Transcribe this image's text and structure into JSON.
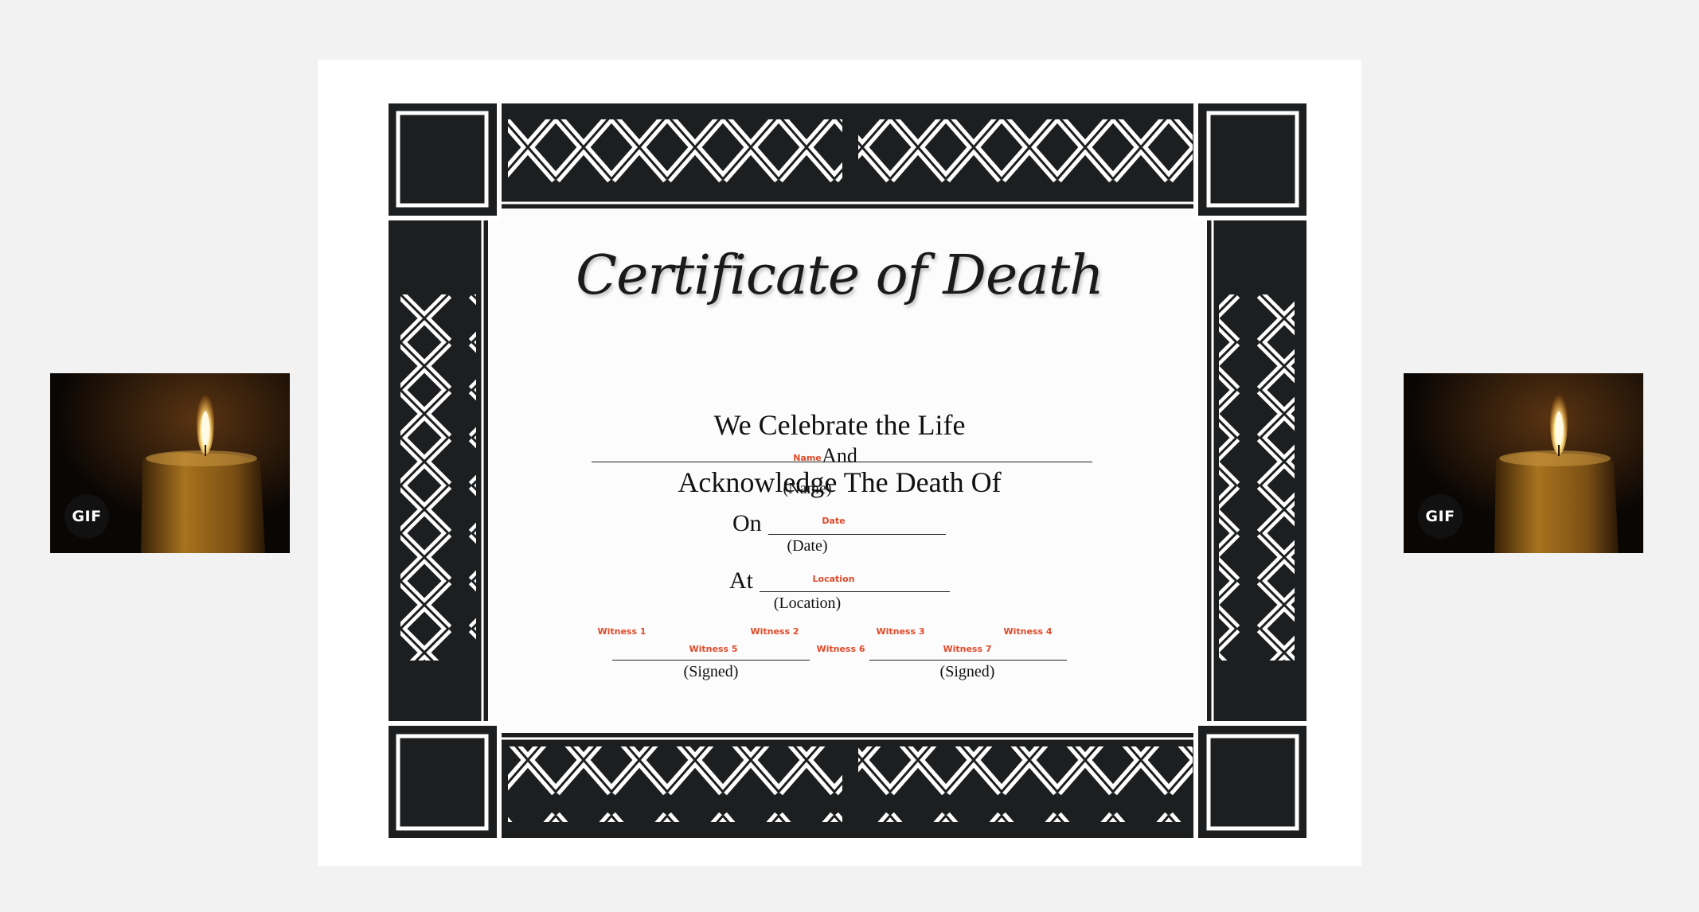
{
  "gifs": [
    {
      "badge": "GIF",
      "alt": "candle-icon"
    },
    {
      "badge": "GIF",
      "alt": "candle-icon"
    }
  ],
  "certificate": {
    "title": "Certificate of Death",
    "line1": "We Celebrate the Life",
    "line2": "And",
    "line3": "Acknowledge The Death Of",
    "name_field": "Name",
    "name_caption": "(Name)",
    "on_label": "On",
    "date_field": "Date",
    "date_caption": "(Date)",
    "at_label": "At",
    "location_field": "Location",
    "location_caption": "(Location)",
    "witness1": "Witness 1",
    "witness2": "Witness 2",
    "witness3": "Witness 3",
    "witness4": "Witness 4",
    "witness5": "Witness 5",
    "witness6": "Witness 6",
    "witness7": "Witness 7",
    "signed_left": "(Signed)",
    "signed_right": "(Signed)"
  },
  "colors": {
    "frame": "#1c1e1f",
    "field": "#e04a2a",
    "background": "#f2f2f2"
  }
}
